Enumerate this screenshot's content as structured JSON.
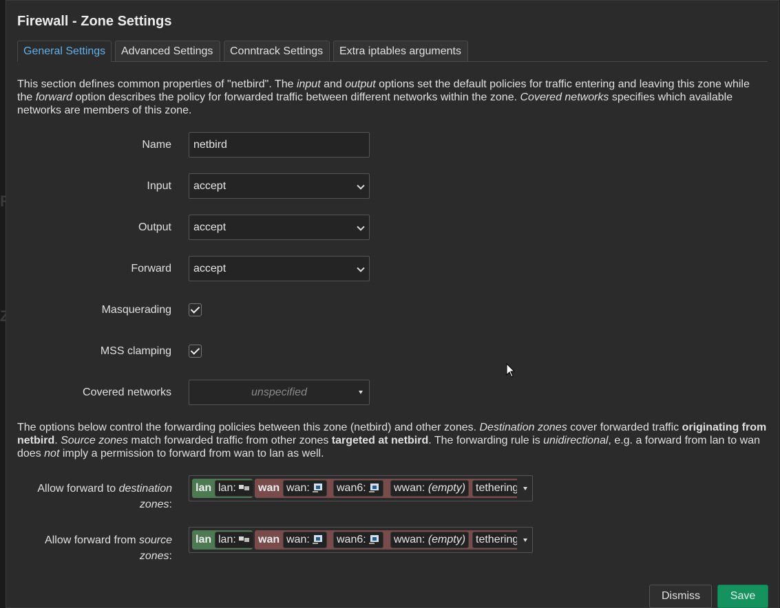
{
  "modal": {
    "title": "Firewall - Zone Settings",
    "tabs": [
      {
        "label": "General Settings",
        "active": true
      },
      {
        "label": "Advanced Settings",
        "active": false
      },
      {
        "label": "Conntrack Settings",
        "active": false
      },
      {
        "label": "Extra iptables arguments",
        "active": false
      }
    ],
    "intro": {
      "p1": "This section defines common properties of \"netbird\". The ",
      "em_input": "input",
      "p2": " and ",
      "em_output": "output",
      "p3": " options set the default policies for traffic entering and leaving this zone while the ",
      "em_forward": "forward",
      "p4": " option describes the policy for forwarded traffic between different networks within the zone. ",
      "em_covered": "Covered networks",
      "p5": " specifies which available networks are members of this zone."
    },
    "fields": {
      "name": {
        "label": "Name",
        "value": "netbird"
      },
      "input": {
        "label": "Input",
        "value": "accept"
      },
      "output": {
        "label": "Output",
        "value": "accept"
      },
      "forward": {
        "label": "Forward",
        "value": "accept"
      },
      "masquerading": {
        "label": "Masquerading",
        "checked": true
      },
      "mss_clamping": {
        "label": "MSS clamping",
        "checked": true
      },
      "covered_networks": {
        "label": "Covered networks",
        "value": "unspecified"
      }
    },
    "forwarding_desc": {
      "p1": "The options below control the forwarding policies between this zone (netbird) and other zones. ",
      "em_dest": "Destination zones",
      "p2": " cover forwarded traffic ",
      "b_orig": "originating from netbird",
      "p3": ". ",
      "em_src": "Source zones",
      "p4": " match forwarded traffic from other zones ",
      "b_target": "targeted at netbird",
      "p5": ". The forwarding rule is ",
      "em_uni": "unidirectional",
      "p6": ", e.g. a forward from lan to wan does ",
      "em_not": "not",
      "p7": " imply a permission to forward from wan to lan as well."
    },
    "dest_zones": {
      "label_prefix": "Allow forward to ",
      "label_em": "destination zones",
      "label_suffix": ":"
    },
    "src_zones": {
      "label_prefix": "Allow forward from ",
      "label_em": "source zones",
      "label_suffix": ":"
    },
    "zone_items": {
      "lan_zone": "lan",
      "lan_net": "lan:",
      "wan_zone": "wan",
      "wan_net": "wan:",
      "wan6_net": "wan6:",
      "wwan_net": "wwan:",
      "wwan_empty": "(empty)",
      "tethering_net": "tethering"
    },
    "buttons": {
      "dismiss": "Dismiss",
      "save": "Save"
    }
  },
  "colors": {
    "lan_zone": "#4d7a52",
    "wan_zone": "#7a4b4b",
    "save_button": "#14935f",
    "active_tab": "#5fb0e8"
  }
}
